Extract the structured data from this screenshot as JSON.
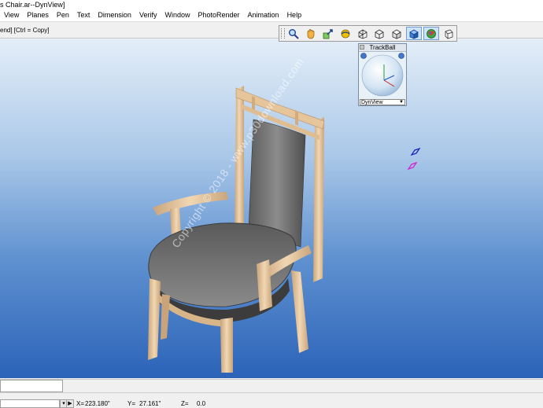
{
  "window": {
    "title": "s Chair.ar--DynView]"
  },
  "menu": {
    "items": [
      "View",
      "Planes",
      "Pen",
      "Text",
      "Dimension",
      "Verify",
      "Window",
      "PhotoRender",
      "Animation",
      "Help"
    ]
  },
  "hint": {
    "text": "end] [Ctrl = Copy]"
  },
  "toolbar": {
    "buttons": [
      {
        "name": "zoom-icon"
      },
      {
        "name": "pan-hand-icon"
      },
      {
        "name": "zoom-extents-icon"
      },
      {
        "name": "rotate-view-icon"
      },
      {
        "name": "wireframe-box-icon"
      },
      {
        "name": "hidden-line-box-icon"
      },
      {
        "name": "shaded-box-icon"
      },
      {
        "name": "solid-box-icon"
      },
      {
        "name": "render-sphere-icon"
      },
      {
        "name": "perspective-box-icon"
      }
    ]
  },
  "trackball": {
    "title": "TrackBall",
    "mode": "DynView"
  },
  "watermark": {
    "text": "Copyright © 2018 - www.p30download.com"
  },
  "status": {
    "x_label": "X=",
    "x_value": "223.180\"",
    "y_label": "Y=",
    "y_value": "27.161\"",
    "z_label": "Z=",
    "z_value": "0.0"
  },
  "colors": {
    "viewport_top": "#e4eef8",
    "viewport_bottom": "#2b63b8",
    "wood": "#e8c9a0",
    "cushion": "#6e6e6e"
  }
}
